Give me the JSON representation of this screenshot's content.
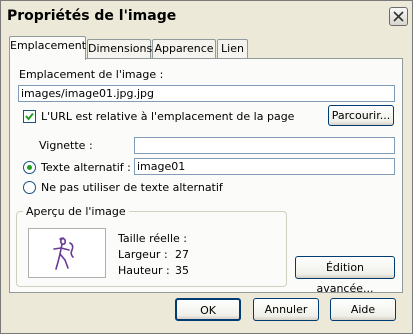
{
  "window": {
    "title": "Propriétés de l'image"
  },
  "tabs": [
    "Emplacement",
    "Dimensions",
    "Apparence",
    "Lien"
  ],
  "location": {
    "label": "Emplacement de l'image :",
    "value": "images/image01.jpg.jpg",
    "relative_label": "L'URL est relative à l'emplacement de la page",
    "relative_checked": true,
    "browse_label": "Parcourir..."
  },
  "thumbnail": {
    "label": "Vignette :",
    "value": ""
  },
  "alt_text": {
    "label": "Texte alternatif :",
    "value": "image01",
    "none_label": "Ne pas utiliser de texte alternatif",
    "selected": "alt"
  },
  "preview": {
    "title": "Aperçu de l'image",
    "size_heading": "Taille réelle :",
    "width_label": "Largeur :",
    "width_value": "27",
    "height_label": "Hauteur :",
    "height_value": "35"
  },
  "buttons": {
    "advanced": "Édition avancée...",
    "ok": "OK",
    "cancel": "Annuler",
    "help": "Aide"
  },
  "colors": {
    "dialog_bg": "#ece9d8",
    "panel_bg": "#fbfbfa",
    "radio_dot": "#21a121",
    "button_border": "#003c74"
  },
  "icons": [
    "close-icon",
    "check-icon",
    "image-thumbnail"
  ]
}
